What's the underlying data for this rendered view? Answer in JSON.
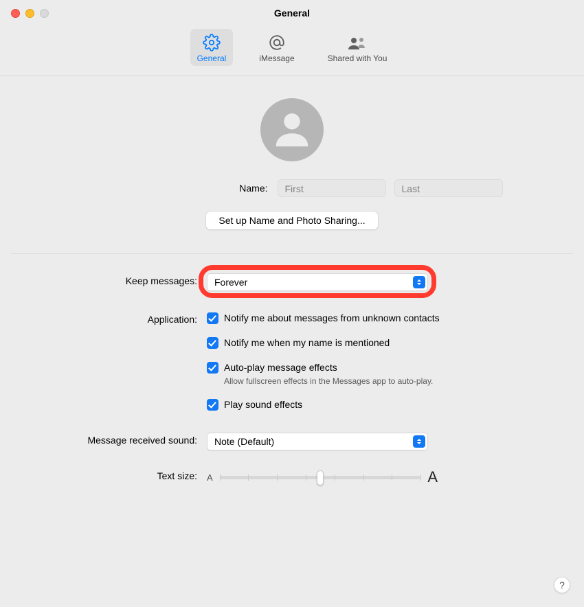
{
  "window": {
    "title": "General"
  },
  "toolbar": {
    "general": "General",
    "imessage": "iMessage",
    "shared": "Shared with You"
  },
  "name": {
    "label": "Name:",
    "first_placeholder": "First",
    "last_placeholder": "Last",
    "setup_button": "Set up Name and Photo Sharing..."
  },
  "keep_messages": {
    "label": "Keep messages:",
    "value": "Forever"
  },
  "application": {
    "label": "Application:",
    "notify_unknown": "Notify me about messages from unknown contacts",
    "notify_mention": "Notify me when my name is mentioned",
    "autoplay": "Auto-play message effects",
    "autoplay_sub": "Allow fullscreen effects in the Messages app to auto-play.",
    "sound_effects": "Play sound effects"
  },
  "received_sound": {
    "label": "Message received sound:",
    "value": "Note (Default)"
  },
  "text_size": {
    "label": "Text size:",
    "small": "A",
    "large": "A"
  },
  "help": "?"
}
